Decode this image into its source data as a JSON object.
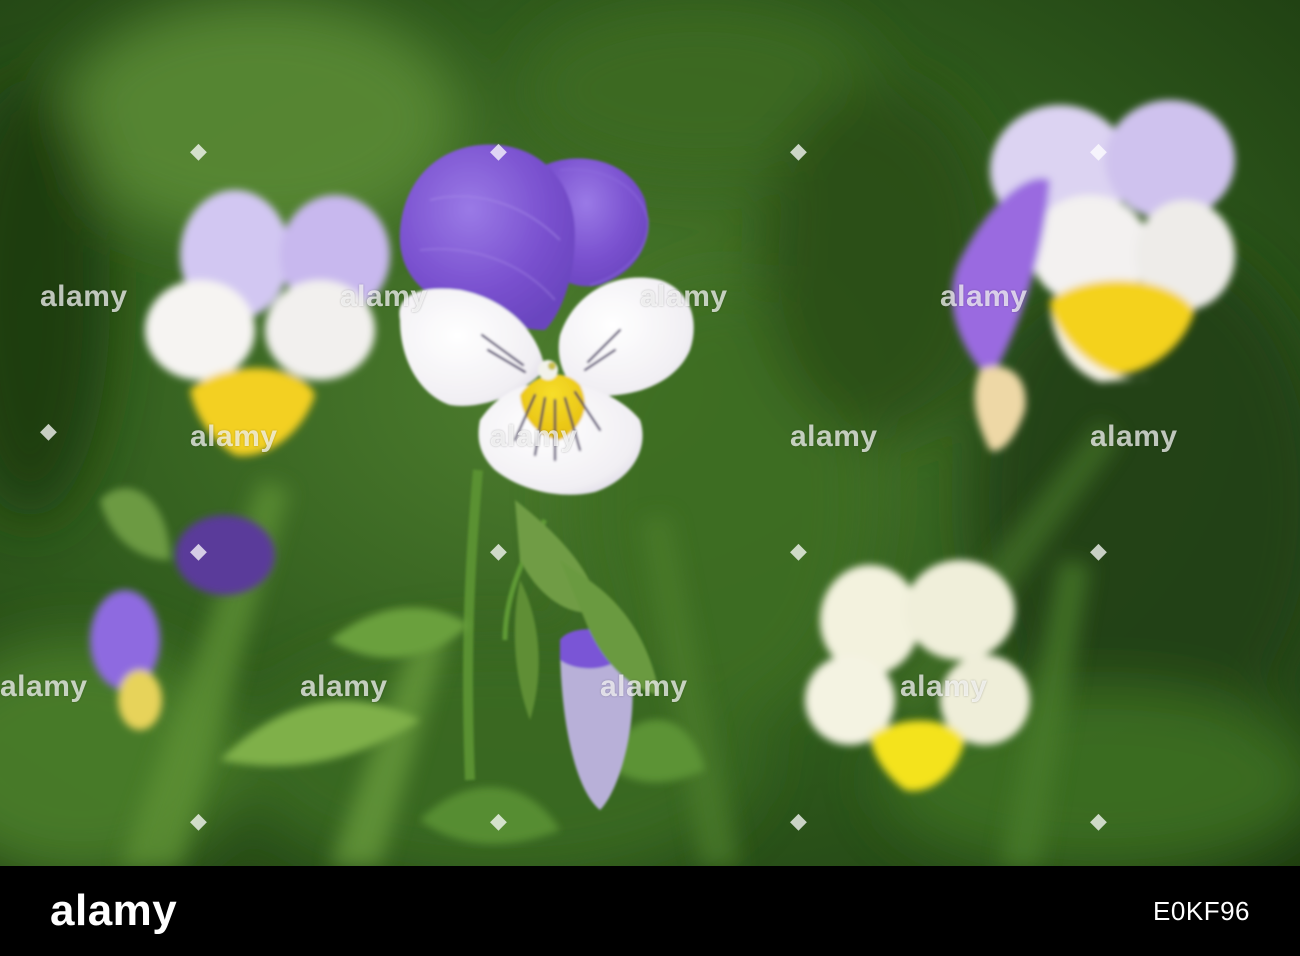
{
  "photo": {
    "subject": "viola-tricolor-flowers",
    "colors": {
      "bg_dark": "#1f3f12",
      "bg_mid": "#3f6b25",
      "bg_light": "#6e9a45",
      "petal_purple": "#8a5fd6",
      "petal_lilac": "#c7b7ea",
      "petal_white": "#f6f4f2",
      "petal_yellow": "#f2d215",
      "stem_green": "#4f8a2c"
    }
  },
  "watermark": {
    "text": "alamy"
  },
  "footer": {
    "logo": "alamy",
    "image_id": "E0KF96",
    "bg": "#000000",
    "fg": "#ffffff"
  }
}
